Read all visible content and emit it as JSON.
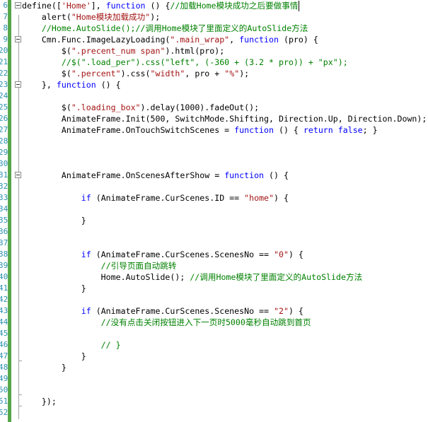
{
  "editor": {
    "colors": {
      "default": "#000000",
      "keyword": "#0000ff",
      "string": "#a31515",
      "comment": "#008000",
      "line_number": "#2b91af",
      "change_bar": "#57a64a"
    },
    "lines": [
      {
        "no": "6",
        "tokens": [
          {
            "t": "define([",
            "c": "default"
          },
          {
            "t": "'Home'",
            "c": "string"
          },
          {
            "t": "], ",
            "c": "default"
          },
          {
            "t": "function",
            "c": "keyword"
          },
          {
            "t": " () {",
            "c": "default"
          },
          {
            "t": "//加载Home模块成功之后要做事情",
            "c": "comment"
          }
        ]
      },
      {
        "no": "7",
        "tokens": [
          {
            "t": "    alert(",
            "c": "default"
          },
          {
            "t": "\"Home模块加载成功\"",
            "c": "string"
          },
          {
            "t": ");",
            "c": "default"
          }
        ]
      },
      {
        "no": "8",
        "tokens": [
          {
            "t": "    //Home.AutoSlide();//调用Home模块了里面定义的AutoSlide方法",
            "c": "comment"
          }
        ]
      },
      {
        "no": "9",
        "tokens": [
          {
            "t": "    Cmn.Func.ImageLazyLoading(",
            "c": "default"
          },
          {
            "t": "\".main_wrap\"",
            "c": "string"
          },
          {
            "t": ", ",
            "c": "default"
          },
          {
            "t": "function",
            "c": "keyword"
          },
          {
            "t": " (pro) {",
            "c": "default"
          }
        ]
      },
      {
        "no": "20",
        "tokens": [
          {
            "t": "        $(",
            "c": "default"
          },
          {
            "t": "\".precent_num span\"",
            "c": "string"
          },
          {
            "t": ").html(pro);",
            "c": "default"
          }
        ]
      },
      {
        "no": "21",
        "tokens": [
          {
            "t": "        //$(\".load_per\").css(\"left\", (-360 + (3.2 * pro)) + \"px\");",
            "c": "comment"
          }
        ]
      },
      {
        "no": "22",
        "tokens": [
          {
            "t": "        $(",
            "c": "default"
          },
          {
            "t": "\".percent\"",
            "c": "string"
          },
          {
            "t": ").css(",
            "c": "default"
          },
          {
            "t": "\"width\"",
            "c": "string"
          },
          {
            "t": ", pro + ",
            "c": "default"
          },
          {
            "t": "\"%\"",
            "c": "string"
          },
          {
            "t": ");",
            "c": "default"
          }
        ]
      },
      {
        "no": "23",
        "tokens": [
          {
            "t": "    }, ",
            "c": "default"
          },
          {
            "t": "function",
            "c": "keyword"
          },
          {
            "t": " () {",
            "c": "default"
          }
        ]
      },
      {
        "no": "24",
        "tokens": []
      },
      {
        "no": "25",
        "tokens": [
          {
            "t": "        $(",
            "c": "default"
          },
          {
            "t": "\".loading_box\"",
            "c": "string"
          },
          {
            "t": ").delay(1000).fadeOut();",
            "c": "default"
          }
        ]
      },
      {
        "no": "26",
        "tokens": [
          {
            "t": "        AnimateFrame.Init(500, SwitchMode.Shifting, Direction.Up, Direction.Down);",
            "c": "default"
          }
        ]
      },
      {
        "no": "27",
        "tokens": [
          {
            "t": "        AnimateFrame.OnTouchSwitchScenes = ",
            "c": "default"
          },
          {
            "t": "function",
            "c": "keyword"
          },
          {
            "t": " () { ",
            "c": "default"
          },
          {
            "t": "return",
            "c": "keyword"
          },
          {
            "t": " ",
            "c": "default"
          },
          {
            "t": "false",
            "c": "keyword"
          },
          {
            "t": "; }",
            "c": "default"
          }
        ]
      },
      {
        "no": "28",
        "tokens": []
      },
      {
        "no": "29",
        "tokens": []
      },
      {
        "no": "30",
        "tokens": []
      },
      {
        "no": "31",
        "tokens": [
          {
            "t": "        AnimateFrame.OnScenesAfterShow = ",
            "c": "default"
          },
          {
            "t": "function",
            "c": "keyword"
          },
          {
            "t": " () {",
            "c": "default"
          }
        ]
      },
      {
        "no": "32",
        "tokens": []
      },
      {
        "no": "33",
        "tokens": [
          {
            "t": "            ",
            "c": "default"
          },
          {
            "t": "if",
            "c": "keyword"
          },
          {
            "t": " (AnimateFrame.CurScenes.ID == ",
            "c": "default"
          },
          {
            "t": "\"home\"",
            "c": "string"
          },
          {
            "t": ") {",
            "c": "default"
          }
        ]
      },
      {
        "no": "34",
        "tokens": []
      },
      {
        "no": "35",
        "tokens": [
          {
            "t": "            }",
            "c": "default"
          }
        ]
      },
      {
        "no": "36",
        "tokens": []
      },
      {
        "no": "37",
        "tokens": []
      },
      {
        "no": "38",
        "tokens": [
          {
            "t": "            ",
            "c": "default"
          },
          {
            "t": "if",
            "c": "keyword"
          },
          {
            "t": " (AnimateFrame.CurScenes.ScenesNo == ",
            "c": "default"
          },
          {
            "t": "\"0\"",
            "c": "string"
          },
          {
            "t": ") {",
            "c": "default"
          }
        ]
      },
      {
        "no": "39",
        "tokens": [
          {
            "t": "                //引导页面自动跳转",
            "c": "comment"
          }
        ]
      },
      {
        "no": "40",
        "tokens": [
          {
            "t": "                Home.AutoSlide(); ",
            "c": "default"
          },
          {
            "t": "//调用Home模块了里面定义的AutoSlide方法",
            "c": "comment"
          }
        ]
      },
      {
        "no": "41",
        "tokens": [
          {
            "t": "            }",
            "c": "default"
          }
        ]
      },
      {
        "no": "42",
        "tokens": []
      },
      {
        "no": "43",
        "tokens": [
          {
            "t": "            ",
            "c": "default"
          },
          {
            "t": "if",
            "c": "keyword"
          },
          {
            "t": " (AnimateFrame.CurScenes.ScenesNo == ",
            "c": "default"
          },
          {
            "t": "\"2\"",
            "c": "string"
          },
          {
            "t": ") {",
            "c": "default"
          }
        ]
      },
      {
        "no": "44",
        "tokens": [
          {
            "t": "                //没有点击关闭按钮进入下一页时5000毫秒自动跳到首页",
            "c": "comment"
          }
        ]
      },
      {
        "no": "45",
        "tokens": []
      },
      {
        "no": "46",
        "tokens": [
          {
            "t": "                // }",
            "c": "comment"
          }
        ]
      },
      {
        "no": "47",
        "tokens": [
          {
            "t": "            }",
            "c": "default"
          }
        ]
      },
      {
        "no": "48",
        "tokens": [
          {
            "t": "        }",
            "c": "default"
          }
        ]
      },
      {
        "no": "49",
        "tokens": []
      },
      {
        "no": "50",
        "tokens": []
      },
      {
        "no": "51",
        "tokens": [
          {
            "t": "    });",
            "c": "default"
          }
        ]
      },
      {
        "no": "52",
        "tokens": []
      }
    ]
  }
}
